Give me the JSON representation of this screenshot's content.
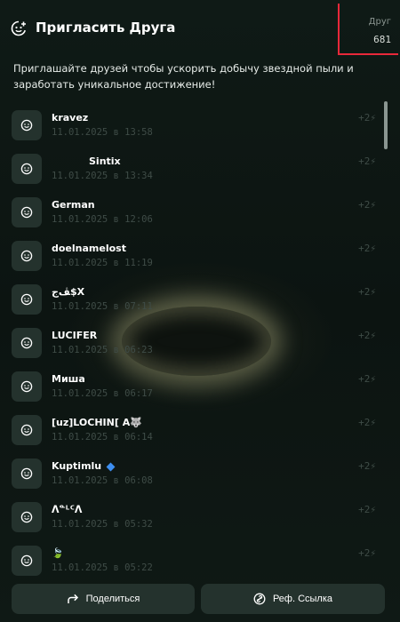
{
  "header": {
    "title": "Пригласить Друга",
    "friends_label": "Друг",
    "friends_count": "681"
  },
  "description": "Приглашайте друзей чтобы ускорить добычу звездной пыли и заработать уникальное достижение!",
  "accent_color": "#e8283a",
  "referrals": [
    {
      "name": "kravez",
      "date": "11.01.2025 в 13:58",
      "bonus": "+2⚡"
    },
    {
      "name": "Sintix",
      "date": "11.01.2025 в 13:34",
      "bonus": "+2⚡"
    },
    {
      "name": "German",
      "date": "11.01.2025 в 12:06",
      "bonus": "+2⚡"
    },
    {
      "name": "doelnamelost",
      "date": "11.01.2025 в 11:19",
      "bonus": "+2⚡"
    },
    {
      "name": "ﭫﺝ$X",
      "date": "11.01.2025 в 07:11",
      "bonus": "+2⚡"
    },
    {
      "name": "LUCIFER",
      "date": "11.01.2025 в 06:23",
      "bonus": "+2⚡"
    },
    {
      "name": "Миша",
      "date": "11.01.2025 в 06:17",
      "bonus": "+2⚡"
    },
    {
      "name": "[uz]LOCHIN[ A🐺",
      "date": "11.01.2025 в 06:14",
      "bonus": "+2⚡"
    },
    {
      "name": "Kuptimlu",
      "date": "11.01.2025 в 06:08",
      "bonus": "+2⚡"
    },
    {
      "name": "ᐱᓐᒻᑦᐱ",
      "date": "11.01.2025 в 05:32",
      "bonus": "+2⚡"
    },
    {
      "name": "🍃",
      "date": "11.01.2025 в 05:22",
      "bonus": "+2⚡"
    }
  ],
  "footer": {
    "share_label": "Поделиться",
    "ref_link_label": "Реф. Ссылка"
  }
}
